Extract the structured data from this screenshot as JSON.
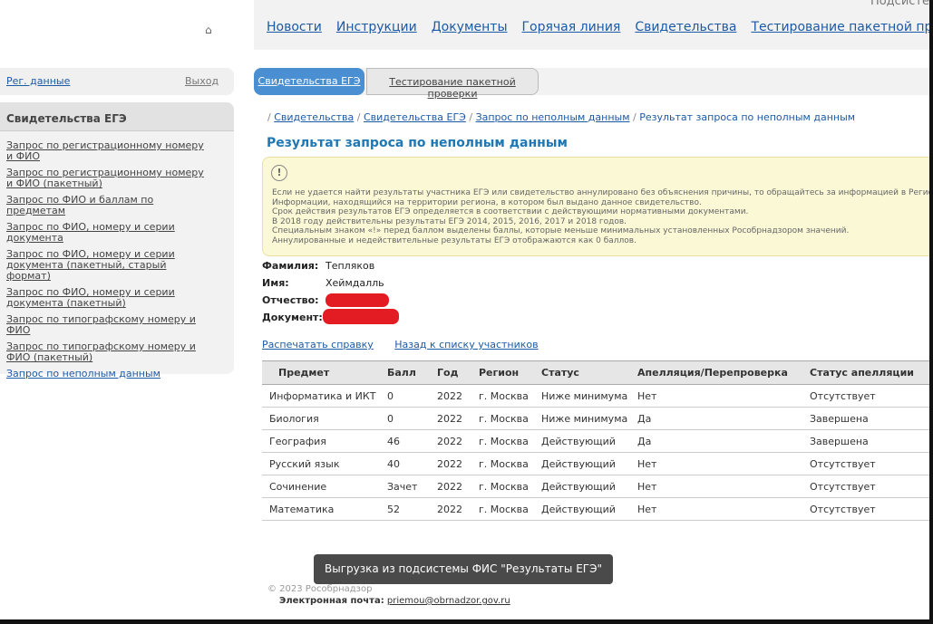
{
  "header": {
    "corner_text": "Подсисте",
    "home_icon": "home-icon",
    "nav": [
      "Новости",
      "Инструкции",
      "Документы",
      "Горячая линия",
      "Свидетельства",
      "Тестирование пакетной проверки"
    ]
  },
  "sidebar": {
    "reg_link": "Рег. данные",
    "logout": "Выход",
    "section_title": "Свидетельства ЕГЭ",
    "items": [
      "Запрос по регистрационному номеру и ФИО",
      "Запрос по регистрационному номеру и ФИО (пакетный)",
      "Запрос по ФИО и баллам по предметам",
      "Запрос по ФИО, номеру и серии документа",
      "Запрос по ФИО, номеру и серии документа (пакетный, старый формат)",
      "Запрос по ФИО, номеру и серии документа (пакетный)",
      "Запрос по типографскому номеру и ФИО",
      "Запрос по типографскому номеру и ФИО (пакетный)",
      "Запрос по неполным данным"
    ]
  },
  "tabs": {
    "active": "Свидетельства ЕГЭ",
    "inactive": "Тестирование пакетной проверки"
  },
  "breadcrumb": {
    "items": [
      "Свидетельства",
      "Свидетельства ЕГЭ",
      "Запрос по неполным данным"
    ],
    "current": "Результат запроса по неполным данным"
  },
  "page_title": "Результат запроса по неполным данным",
  "notice": {
    "icon": "!",
    "lines": [
      "Если не удается найти результаты участника ЕГЭ или свидетельство аннулировано без объяснения причины, то обращайтесь за информацией в Регион",
      "Информации, находящийся на территории региона, в котором был выдано данное свидетельство.",
      "Срок действия результатов ЕГЭ определяется в соответствии с действующими нормативными документами.",
      "В 2018 году действительны результаты ЕГЭ 2014, 2015, 2016, 2017 и 2018 годов.",
      "Специальным знаком «!» перед баллом выделены баллы, которые меньше минимальных установленных Рособрнадзором значений.",
      "Аннулированные и недействительные результаты ЕГЭ отображаются как 0 баллов."
    ]
  },
  "person": {
    "surname_label": "Фамилия:",
    "surname": "Тепляков",
    "name_label": "Имя:",
    "name": "Хеймдалль",
    "patronymic_label": "Отчество:",
    "document_label": "Документ:"
  },
  "actions": {
    "print": "Распечатать справку",
    "back": "Назад к списку участников"
  },
  "table": {
    "headers": [
      "Предмет",
      "Балл",
      "Год",
      "Регион",
      "Статус",
      "Апелляция/Перепроверка",
      "Статус апелляции"
    ],
    "rows": [
      [
        "Информатика и ИКТ",
        "0",
        "2022",
        "г. Москва",
        "Ниже минимума",
        "Нет",
        "Отсутствует"
      ],
      [
        "Биология",
        "0",
        "2022",
        "г. Москва",
        "Ниже минимума",
        "Да",
        "Завершена"
      ],
      [
        "География",
        "46",
        "2022",
        "г. Москва",
        "Действующий",
        "Да",
        "Завершена"
      ],
      [
        "Русский язык",
        "40",
        "2022",
        "г. Москва",
        "Действующий",
        "Нет",
        "Отсутствует"
      ],
      [
        "Сочинение",
        "Зачет",
        "2022",
        "г. Москва",
        "Действующий",
        "Нет",
        "Отсутствует"
      ],
      [
        "Математика",
        "52",
        "2022",
        "г. Москва",
        "Действующий",
        "Нет",
        "Отсутствует"
      ]
    ]
  },
  "toast": "Выгрузка из подсистемы ФИС \"Результаты ЕГЭ\"",
  "footer": {
    "copyright": "© 2023 Рособрнадзор",
    "email_label": "Электронная почта:",
    "email": "priemou@obrnadzor.gov.ru"
  },
  "colors": {
    "link": "#1c5aa5",
    "title": "#1f78b4",
    "active_tab": "#4a8fd1",
    "redaction": "#e31b23",
    "below_minimum_score": "#dd0000"
  }
}
